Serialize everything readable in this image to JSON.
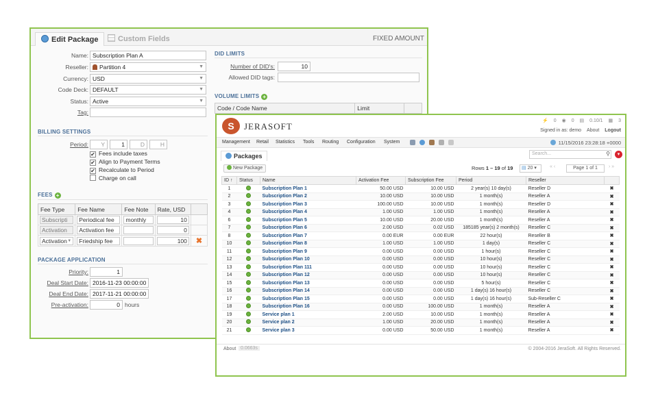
{
  "edit": {
    "tab_edit": "Edit Package",
    "tab_custom": "Custom Fields",
    "fixed_amount": "FIXED AMOUNT",
    "labels": {
      "name": "Name:",
      "reseller": "Reseller:",
      "currency": "Currency:",
      "code_deck": "Code Deck:",
      "status": "Status:",
      "tag": "Tag:"
    },
    "values": {
      "name": "Subscription Plan A",
      "reseller": "Partition 4",
      "currency": "USD",
      "code_deck": "DEFAULT",
      "status": "Active",
      "tag": ""
    },
    "billing": {
      "title": "BILLING SETTINGS",
      "period_label": "Period:",
      "period_y": "Y",
      "period_val": "1",
      "period_d": "D",
      "period_h": "H",
      "checks": [
        {
          "label": "Fees include taxes",
          "checked": true
        },
        {
          "label": "Align to Payment Terms",
          "checked": true
        },
        {
          "label": "Recalculate to Period",
          "checked": true
        },
        {
          "label": "Charge on call",
          "checked": false
        }
      ]
    },
    "fees": {
      "title": "FEES",
      "headers": [
        "Fee Type",
        "Fee Name",
        "Fee Note",
        "Rate, USD"
      ],
      "rows": [
        {
          "type": "Subscripti",
          "name": "Periodical fee",
          "note": "monthly",
          "rate": "10"
        },
        {
          "type": "Activation",
          "name": "Activation fee",
          "note": "",
          "rate": "0"
        },
        {
          "type": "Activation",
          "name": "Friedship fee",
          "note": "",
          "rate": "100"
        }
      ]
    },
    "app": {
      "title": "PACKAGE APPLICATION",
      "priority_label": "Priority:",
      "priority": "1",
      "start_label": "Deal Start Date:",
      "start": "2016-11-23 00:00:00",
      "end_label": "Deal End Date:",
      "end": "2017-11-21 00:00:00",
      "preact_label": "Pre-activation:",
      "preact": "0",
      "preact_unit": "hours"
    },
    "did": {
      "title": "DID LIMITS",
      "num_label": "Number of DID's:",
      "num": "10",
      "tags_label": "Allowed DID tags:",
      "tags": ""
    },
    "volume": {
      "title": "VOLUME LIMITS",
      "col1": "Code / Code Name",
      "col2": "Limit"
    }
  },
  "app": {
    "brand": "JERASOFT",
    "top": {
      "a": "0",
      "b": "0",
      "c": "0.10/1",
      "d": "3"
    },
    "signed_in": "Signed in as: demo",
    "about": "About",
    "logout": "Logout",
    "menu": [
      "Management",
      "Retail",
      "Statistics",
      "Tools",
      "Routing",
      "Configuration",
      "System"
    ],
    "datetime": "11/15/2016 23:28:18 +0000",
    "title": "Packages",
    "search_placeholder": "Search...",
    "new_package": "New Package",
    "rows_prefix": "Rows ",
    "rows_range": "1 – 19",
    "rows_of": " of ",
    "rows_total": "19",
    "per_page": "20",
    "page_info": "Page 1 of 1",
    "columns": [
      "ID",
      "Status",
      "Name",
      "Activation Fee",
      "Subscription Fee",
      "Period",
      "Reseller"
    ],
    "packages": [
      {
        "id": "1",
        "name": "Subscription Plan 1",
        "act": "50.00 USD",
        "sub": "10.00 USD",
        "period": "2 year(s) 10 day(s)",
        "reseller": "Reseller D"
      },
      {
        "id": "2",
        "name": "Subscription Plan 2",
        "act": "10.00 USD",
        "sub": "10.00 USD",
        "period": "1 month(s)",
        "reseller": "Reseller A"
      },
      {
        "id": "3",
        "name": "Subscription Plan 3",
        "act": "100.00 USD",
        "sub": "10.00 USD",
        "period": "1 month(s)",
        "reseller": "Reseller D"
      },
      {
        "id": "4",
        "name": "Subscription Plan 4",
        "act": "1.00 USD",
        "sub": "1.00 USD",
        "period": "1 month(s)",
        "reseller": "Reseller A"
      },
      {
        "id": "6",
        "name": "Subscription Plan 5",
        "act": "10.00 USD",
        "sub": "20.00 USD",
        "period": "1 month(s)",
        "reseller": "Reseller A"
      },
      {
        "id": "7",
        "name": "Subscription Plan 6",
        "act": "2.00 USD",
        "sub": "0.02 USD",
        "period": "185185 year(s) 2 month(s)",
        "reseller": "Reseller C"
      },
      {
        "id": "8",
        "name": "Subscription Plan 7",
        "act": "0.00 EUR",
        "sub": "0.00 EUR",
        "period": "22 hour(s)",
        "reseller": "Reseller B"
      },
      {
        "id": "10",
        "name": "Subscription Plan 8",
        "act": "1.00 USD",
        "sub": "1.00 USD",
        "period": "1 day(s)",
        "reseller": "Reseller C"
      },
      {
        "id": "11",
        "name": "Subscription Plan 9",
        "act": "0.00 USD",
        "sub": "0.00 USD",
        "period": "1 hour(s)",
        "reseller": "Reseller C"
      },
      {
        "id": "12",
        "name": "Subscription Plan 10",
        "act": "0.00 USD",
        "sub": "0.00 USD",
        "period": "10 hour(s)",
        "reseller": "Reseller C"
      },
      {
        "id": "13",
        "name": "Subscription Plan 111",
        "act": "0.00 USD",
        "sub": "0.00 USD",
        "period": "10 hour(s)",
        "reseller": "Reseller C"
      },
      {
        "id": "14",
        "name": "Subscription Plan 12",
        "act": "0.00 USD",
        "sub": "0.00 USD",
        "period": "10 hour(s)",
        "reseller": "Reseller C"
      },
      {
        "id": "15",
        "name": "Subscription Plan 13",
        "act": "0.00 USD",
        "sub": "0.00 USD",
        "period": "5 hour(s)",
        "reseller": "Reseller C"
      },
      {
        "id": "16",
        "name": "Subscription Plan 14",
        "act": "0.00 USD",
        "sub": "0.00 USD",
        "period": "1 day(s) 16 hour(s)",
        "reseller": "Reseller C"
      },
      {
        "id": "17",
        "name": "Subscription Plan 15",
        "act": "0.00 USD",
        "sub": "0.00 USD",
        "period": "1 day(s) 16 hour(s)",
        "reseller": "Sub-Reseller C"
      },
      {
        "id": "18",
        "name": "Subscription Plan 16",
        "act": "0.00 USD",
        "sub": "100.00 USD",
        "period": "1 month(s)",
        "reseller": "Reseller A"
      },
      {
        "id": "19",
        "name": "Service plan 1",
        "act": "2.00 USD",
        "sub": "10.00 USD",
        "period": "1 month(s)",
        "reseller": "Reseller A"
      },
      {
        "id": "20",
        "name": "Service plan 2",
        "act": "1.00 USD",
        "sub": "20.00 USD",
        "period": "1 month(s)",
        "reseller": "Reseller A"
      },
      {
        "id": "21",
        "name": "Service plan 3",
        "act": "0.00 USD",
        "sub": "50.00 USD",
        "period": "1 month(s)",
        "reseller": "Reseller A"
      }
    ],
    "footer_about": "About",
    "footer_version": "0.0663s",
    "copyright": "© 2004-2016 JeraSoft. All Rights Reserved."
  },
  "colors": {
    "frame": "#8fc44e",
    "link": "#1d4f85",
    "brand": "#c9552d",
    "accent_green": "#6cb33f",
    "delete": "#e8742c"
  }
}
